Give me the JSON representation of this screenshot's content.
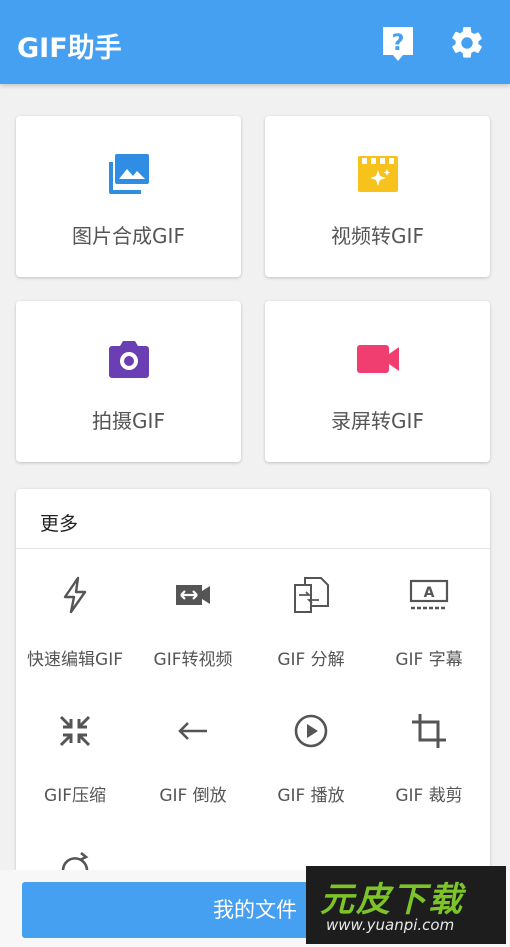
{
  "app": {
    "title": "GIF助手"
  },
  "header_icons": [
    "help-icon",
    "settings-icon"
  ],
  "main_actions": [
    {
      "label": "图片合成GIF",
      "icon": "image-icon",
      "color": "#2f8de4"
    },
    {
      "label": "视频转GIF",
      "icon": "video-clapper-icon",
      "color": "#f7c21b"
    },
    {
      "label": "拍摄GIF",
      "icon": "camera-icon",
      "color": "#6a3fb4"
    },
    {
      "label": "录屏转GIF",
      "icon": "record-video-icon",
      "color": "#ef3e6f"
    }
  ],
  "more": {
    "title": "更多",
    "tools": [
      {
        "label": "快速编辑GIF",
        "icon": "flash-icon"
      },
      {
        "label": "GIF转视频",
        "icon": "video-convert-icon"
      },
      {
        "label": "GIF 分解",
        "icon": "split-pages-icon"
      },
      {
        "label": "GIF 字幕",
        "icon": "subtitle-icon"
      },
      {
        "label": "GIF压缩",
        "icon": "compress-icon"
      },
      {
        "label": "GIF 倒放",
        "icon": "arrow-left-icon"
      },
      {
        "label": "GIF 播放",
        "icon": "play-circle-icon"
      },
      {
        "label": "GIF 裁剪",
        "icon": "crop-icon"
      }
    ]
  },
  "bottom": {
    "button_label": "我的文件"
  },
  "watermark": {
    "logo": "元皮下载",
    "url": "www.yuanpi.com"
  }
}
